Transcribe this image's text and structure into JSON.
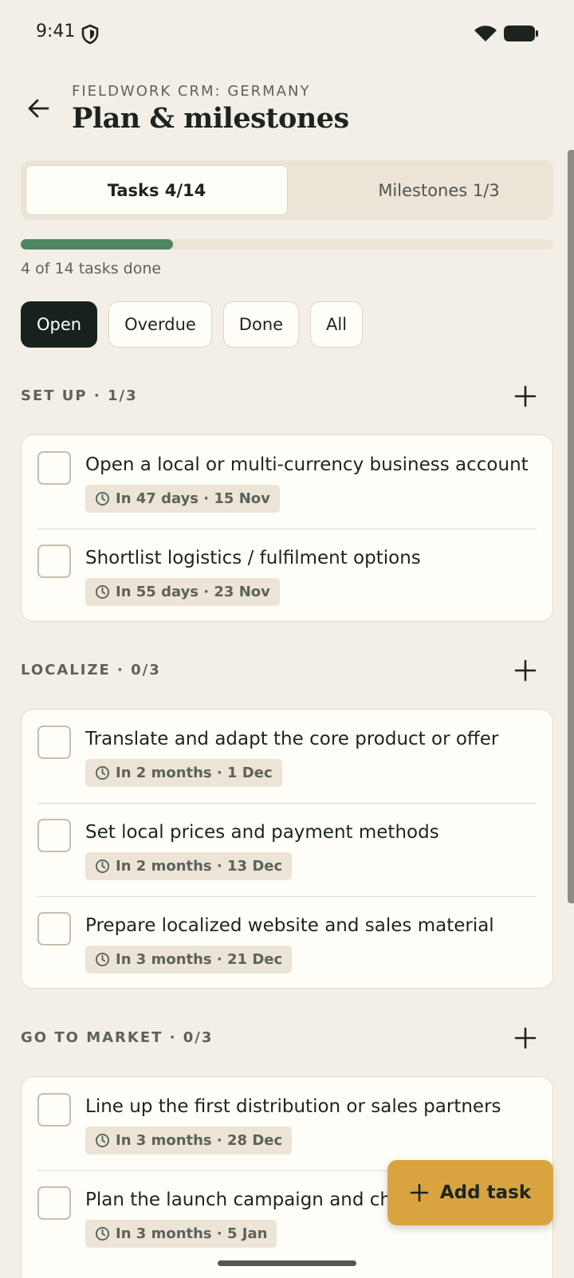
{
  "status_bar": {
    "time": "9:41"
  },
  "header": {
    "eyebrow": "FIELDWORK CRM: GERMANY",
    "title": "Plan & milestones"
  },
  "tabs": [
    {
      "label": "Tasks 4/14",
      "active": true
    },
    {
      "label": "Milestones 1/3",
      "active": false
    }
  ],
  "progress": {
    "done": 4,
    "total": 14,
    "fraction": 0.2857,
    "label": "4 of 14 tasks done"
  },
  "filters": [
    {
      "label": "Open",
      "active": true
    },
    {
      "label": "Overdue",
      "active": false
    },
    {
      "label": "Done",
      "active": false
    },
    {
      "label": "All",
      "active": false
    }
  ],
  "sections": [
    {
      "label": "SET UP · 1/3",
      "tasks": [
        {
          "title": "Open a local or multi-currency business account",
          "due": "In 47 days · 15 Nov"
        },
        {
          "title": "Shortlist logistics / fulfilment options",
          "due": "In 55 days · 23 Nov"
        }
      ]
    },
    {
      "label": "LOCALIZE · 0/3",
      "tasks": [
        {
          "title": "Translate and adapt the core product or offer",
          "due": "In 2 months · 1 Dec"
        },
        {
          "title": "Set local prices and payment methods",
          "due": "In 2 months · 13 Dec"
        },
        {
          "title": "Prepare localized website and sales material",
          "due": "In 3 months · 21 Dec"
        }
      ]
    },
    {
      "label": "GO TO MARKET · 0/3",
      "tasks": [
        {
          "title": "Line up the first distribution or sales partners",
          "due": "In 3 months · 28 Dec"
        },
        {
          "title": "Plan the launch campaign and char",
          "due": "In 3 months · 5 Jan"
        }
      ]
    }
  ],
  "fab": {
    "label": "Add task"
  },
  "colors": {
    "accent": "#4f8563",
    "fab": "#d9a440",
    "active_chip": "#17221c",
    "background": "#f4efe6"
  }
}
